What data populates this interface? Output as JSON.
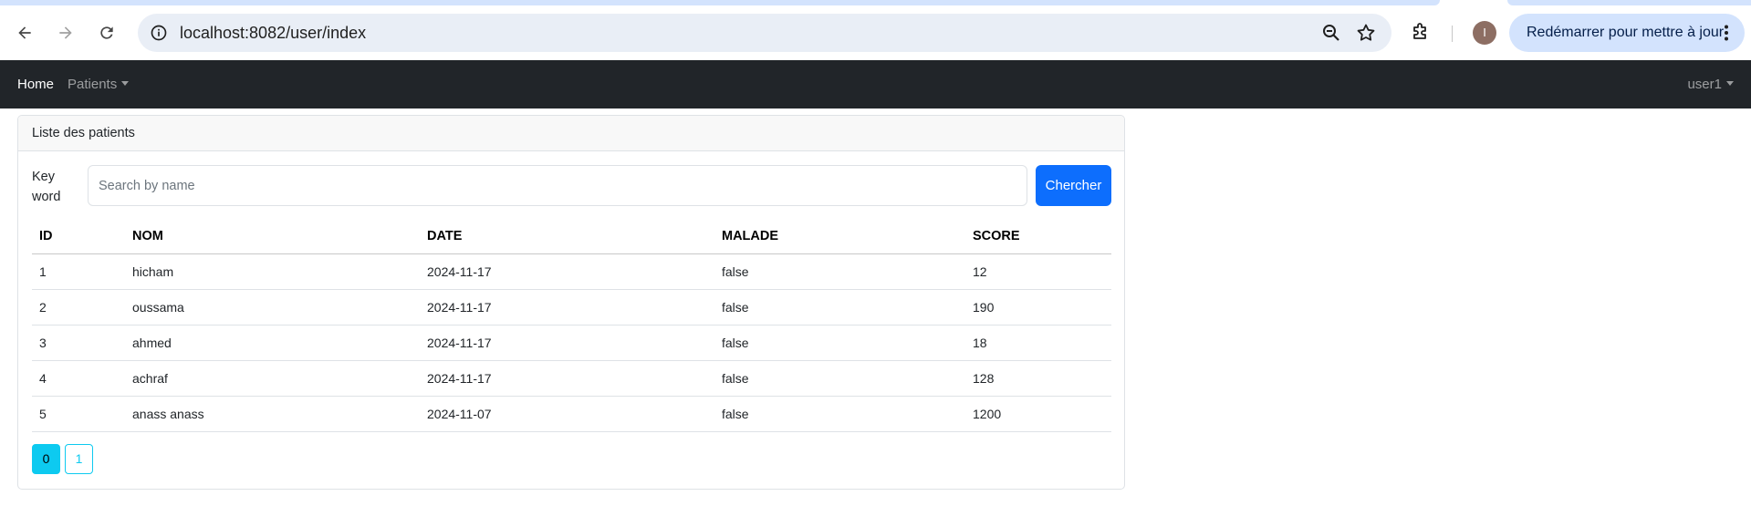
{
  "browser": {
    "url": "localhost:8082/user/index",
    "profile_initial": "I",
    "update_label": "Redémarrer pour mettre à jour"
  },
  "navbar": {
    "brand": "Home",
    "patients_menu": "Patients",
    "user_menu": "user1"
  },
  "card": {
    "header": "Liste des patients",
    "keyword_label": "Key word",
    "search_placeholder": "Search by name",
    "search_value": "",
    "search_button": "Chercher"
  },
  "table": {
    "columns": [
      "ID",
      "NOM",
      "DATE",
      "MALADE",
      "SCORE"
    ],
    "rows": [
      [
        "1",
        "hicham",
        "2024-11-17",
        "false",
        "12"
      ],
      [
        "2",
        "oussama",
        "2024-11-17",
        "false",
        "190"
      ],
      [
        "3",
        "ahmed",
        "2024-11-17",
        "false",
        "18"
      ],
      [
        "4",
        "achraf",
        "2024-11-17",
        "false",
        "128"
      ],
      [
        "5",
        "anass anass",
        "2024-11-07",
        "false",
        "1200"
      ]
    ]
  },
  "pagination": {
    "pages": [
      "0",
      "1"
    ],
    "active": "0"
  },
  "colors": {
    "navbar_bg": "#212529",
    "primary": "#0d6efd",
    "info": "#0dcaf0"
  }
}
